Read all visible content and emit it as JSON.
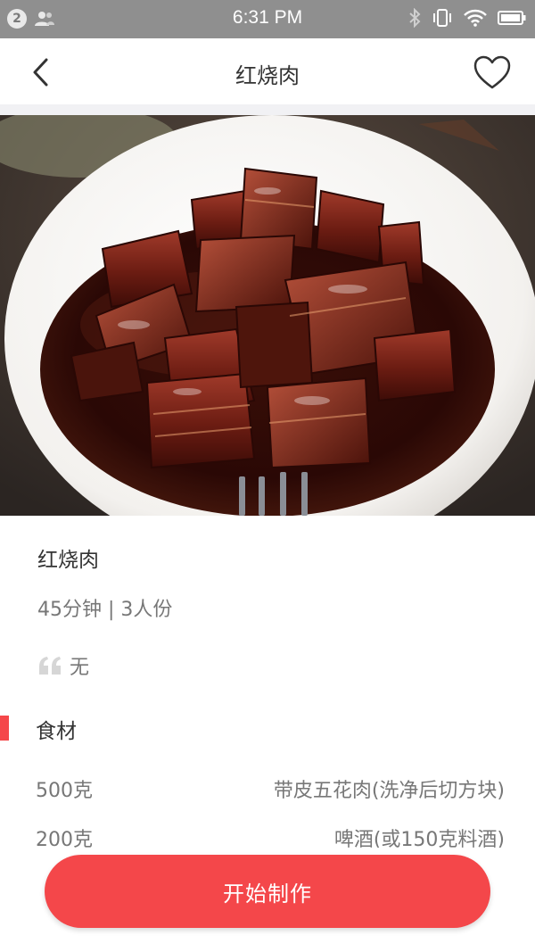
{
  "status_bar": {
    "notification_count": "2",
    "time": "6:31 PM",
    "icons": [
      "person-icon",
      "bluetooth-icon",
      "vibrate-icon",
      "wifi-icon",
      "battery-icon"
    ]
  },
  "nav": {
    "title": "红烧肉",
    "back_icon": "back-arrow-icon",
    "favorite_icon": "heart-icon"
  },
  "dish": {
    "name": "红烧肉",
    "meta": "45分钟 | 3人份",
    "tip": "无"
  },
  "ingredients": {
    "title": "食材",
    "items": [
      {
        "qty": "500克",
        "name": "带皮五花肉(洗净后切方块)"
      },
      {
        "qty": "200克",
        "name": "啤酒(或150克料酒)"
      }
    ]
  },
  "action": {
    "start_label": "开始制作"
  },
  "colors": {
    "accent": "#f4474a",
    "status_bar": "#8f8f8f"
  }
}
